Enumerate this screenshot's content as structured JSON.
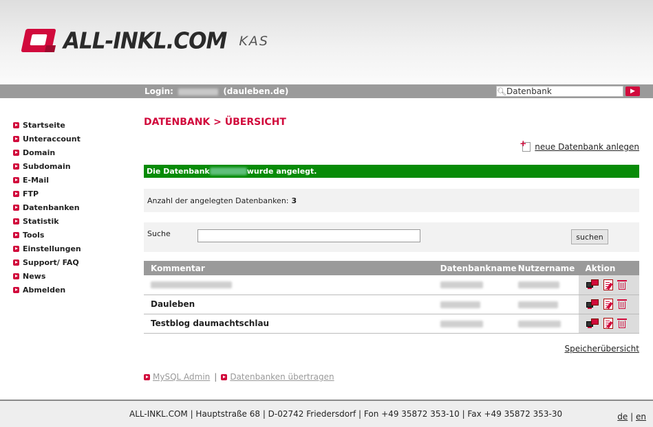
{
  "header": {
    "logo_text": "ALL-INKL.COM",
    "logo_suffix": "KAS"
  },
  "topbar": {
    "login_label": "Login:",
    "login_domain": "(dauleben.de)",
    "search_value": "Datenbank",
    "go_icon": "play-arrow-icon"
  },
  "sidebar": {
    "items": [
      {
        "label": "Startseite"
      },
      {
        "label": "Unteraccount"
      },
      {
        "label": "Domain"
      },
      {
        "label": "Subdomain"
      },
      {
        "label": "E-Mail"
      },
      {
        "label": "FTP"
      },
      {
        "label": "Datenbanken"
      },
      {
        "label": "Statistik"
      },
      {
        "label": "Tools"
      },
      {
        "label": "Einstellungen"
      },
      {
        "label": "Support/ FAQ"
      },
      {
        "label": "News"
      },
      {
        "label": "Abmelden"
      }
    ]
  },
  "main": {
    "title": "DATENBANK > ÜBERSICHT",
    "new_db_link": "neue Datenbank anlegen",
    "success_prefix": "Die Datenbank",
    "success_suffix": "wurde angelegt.",
    "count_label": "Anzahl der angelegten Datenbanken:",
    "count_value": "3",
    "search_label": "Suche",
    "search_value": "",
    "search_button": "suchen",
    "table": {
      "headers": [
        "Kommentar",
        "Datenbankname",
        "Nutzername",
        "Aktion"
      ],
      "rows": [
        {
          "comment": ""
        },
        {
          "comment": "Dauleben"
        },
        {
          "comment": "Testblog daumachtschlau"
        }
      ]
    },
    "storage_link": "Speicherübersicht",
    "links": {
      "mysql_admin": "MySQL Admin",
      "separator": "|",
      "transfer": "Datenbanken übertragen"
    }
  },
  "footer": {
    "address": "ALL-INKL.COM | Hauptstraße 68 | D-02742 Friedersdorf | Fon +49 35872 353-10 | Fax +49 35872 353-30",
    "lang_de": "de",
    "lang_sep": "|",
    "lang_en": "en"
  },
  "colors": {
    "accent": "#d10a3c",
    "success": "#078b07",
    "bar": "#9a9a9a"
  }
}
